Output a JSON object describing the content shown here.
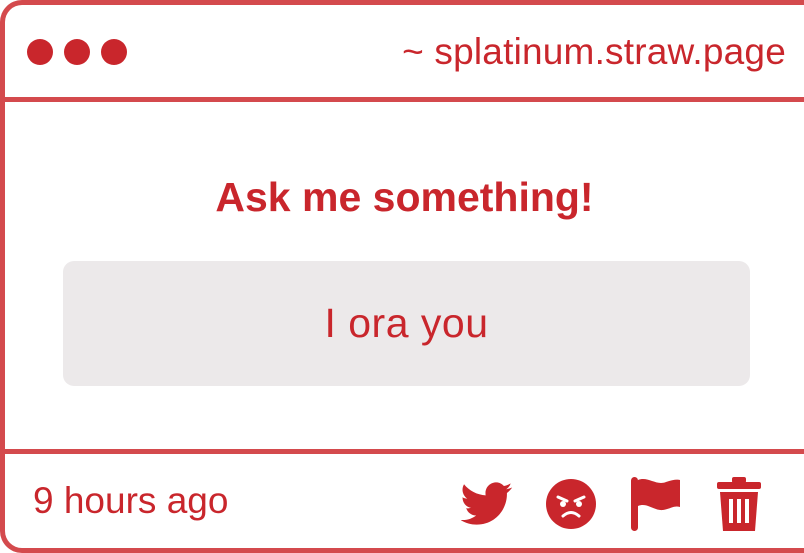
{
  "window": {
    "url": "~ splatinum.straw.page"
  },
  "question": {
    "prompt": "Ask me something!",
    "answer": "I ora you"
  },
  "footer": {
    "timestamp": "9 hours ago",
    "actions": [
      {
        "icon": "twitter-bird-icon"
      },
      {
        "icon": "angry-face-icon"
      },
      {
        "icon": "flag-icon"
      },
      {
        "icon": "trash-icon"
      }
    ]
  },
  "colors": {
    "accent": "#c9262c",
    "border": "#d44a4d",
    "answer_bg": "#ece9ea",
    "background": "#ffffff"
  }
}
